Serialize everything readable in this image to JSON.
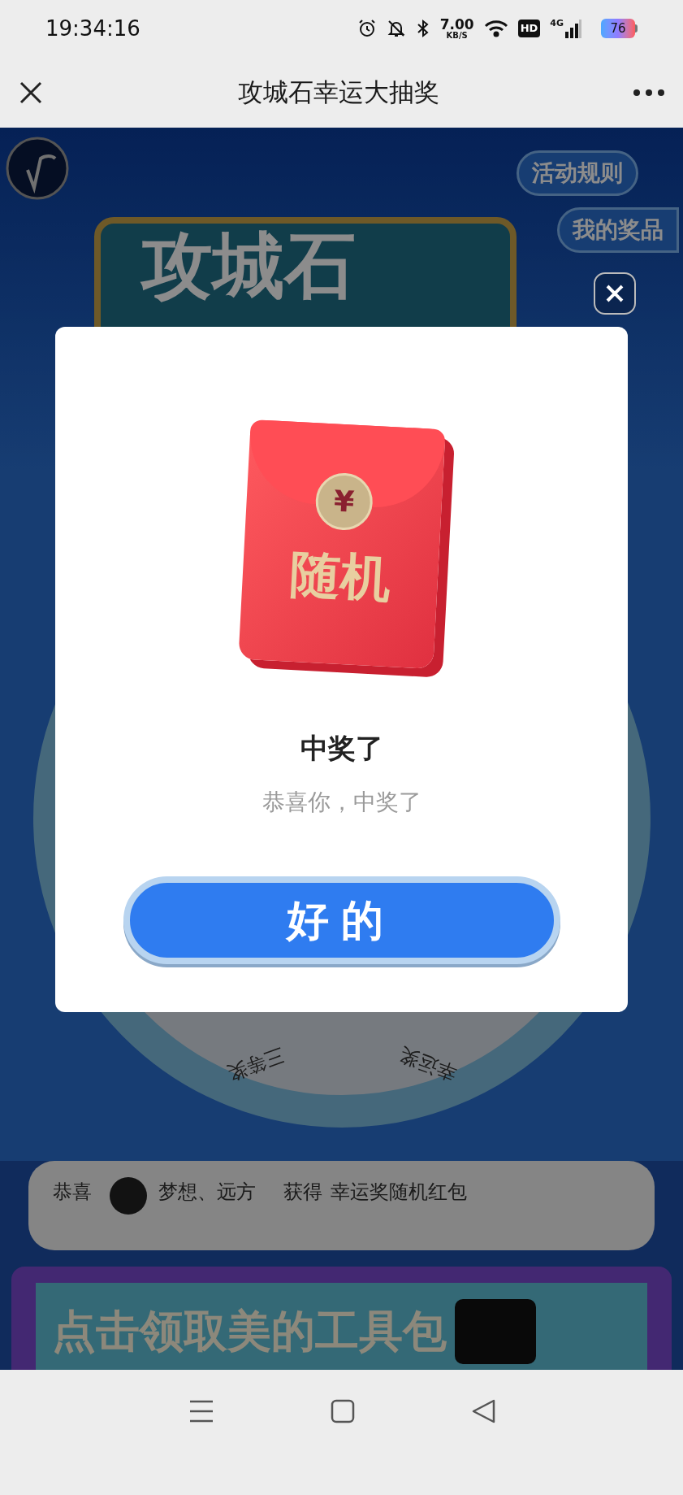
{
  "status_bar": {
    "time": "19:34:16",
    "speed": "7.00",
    "speed_unit": "KB/S",
    "hd": "HD",
    "network": "4G",
    "battery": "76"
  },
  "nav": {
    "title": "攻城石幸运大抽奖"
  },
  "page": {
    "rules_button": "活动规则",
    "prizes_button": "我的奖品",
    "banner_title": "攻城石",
    "wheel_labels": [
      "三等奖",
      "幸运奖"
    ],
    "ticker": {
      "prefix": "恭喜",
      "user": "梦想、远方",
      "verb": "获得",
      "prize": "幸运奖随机红包"
    },
    "promo": "点击领取美的工具包"
  },
  "dialog": {
    "envelope_symbol": "¥",
    "envelope_text": "随机",
    "title": "中奖了",
    "message": "恭喜你，中奖了",
    "button": "好的"
  }
}
